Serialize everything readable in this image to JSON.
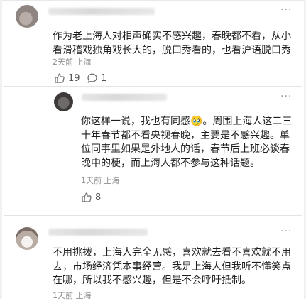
{
  "comments": [
    {
      "text_lines": [
        "作为老上海人对相声确实不感兴趣，春晚都不看，从小",
        "看滑稽戏独角戏长大的，脱口秀看的，也看沪语脱口秀"
      ],
      "meta": "2天前 上海",
      "likes": "19",
      "replies": "1"
    },
    {
      "text_lines": [
        "你这样一说，我也有同感🥹。周围上海人这二三",
        "十年春节都不看央视春晚，主要是不感兴趣。单",
        "位同事里如果是外地人的话，春节后上班必谈春",
        "晚中的梗，而上海人都不参与这种话题。"
      ],
      "meta": "1天前 上海",
      "likes": "8"
    },
    {
      "text_lines": [
        "不用挑拨，上海人完全无感，喜欢就去看不喜欢就不用",
        "去，市场经济凭本事经营。我是上海人但我听不懂笑点",
        "在哪，所以我不感兴趣，但是不会呼吁抵制。"
      ],
      "meta": "1天前 上海"
    }
  ],
  "icons": {
    "more": "more-dots-icon",
    "like": "thumb-up-icon",
    "reply": "comment-bubble-icon"
  },
  "more_label": "···"
}
